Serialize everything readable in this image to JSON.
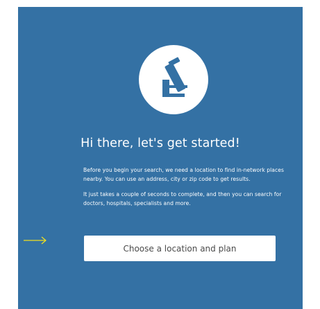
{
  "welcome": {
    "icon": "microscope-icon",
    "heading": "Hi there, let's get started!",
    "paragraph_1": "Before you begin your search, we need a location to find in-network places nearby. You can use an address, city or zip code to get results.",
    "paragraph_2": "It just takes a couple of seconds to complete, and then you can search for doctors, hospitals, specialists and more.",
    "cta_label": "Choose a location and plan"
  },
  "annotation": {
    "icon": "arrow-right-icon",
    "color": "#f2e01e"
  },
  "colors": {
    "panel_background": "#3471a4",
    "accent": "#3471a4",
    "button_background": "#ffffff",
    "button_text": "#4a4a4a"
  }
}
